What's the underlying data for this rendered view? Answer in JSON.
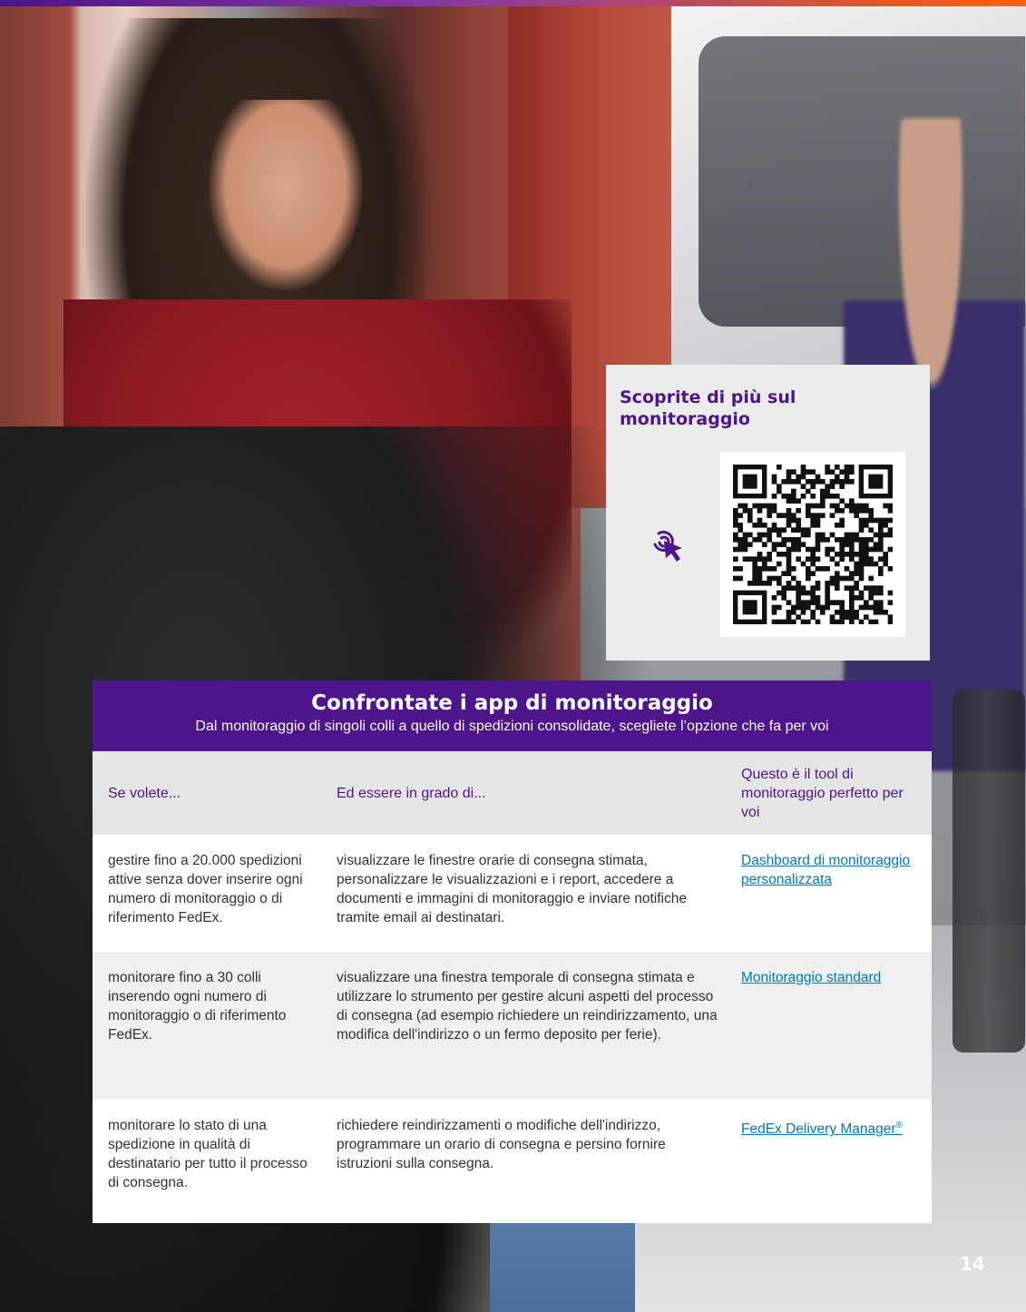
{
  "colors": {
    "brand_purple": "#4d148c",
    "link_blue": "#007ab7",
    "accent_orange": "#ff6200"
  },
  "qr_card": {
    "title": "Scoprite di più sul monitoraggio",
    "cursor_icon": "click-cursor-icon",
    "qr_icon": "qr-code"
  },
  "compare": {
    "title": "Confrontate i app di monitoraggio",
    "subtitle": "Dal monitoraggio di singoli colli a quello di spedizioni consolidate, scegliete l’opzione che fa per voi",
    "headers": [
      "Se volete...",
      "Ed essere in grado di...",
      "Questo è il tool di monitoraggio perfetto per voi"
    ],
    "rows": [
      {
        "want": "gestire fino a 20.000 spedizioni attive senza dover inserire ogni numero di monitoraggio o di riferimento FedEx.",
        "able": "visualizzare le finestre orarie di consegna stimata, personalizzare le visualizzazioni e i report, accedere a documenti e immagini di monitoraggio e inviare notifiche tramite email ai destinatari.",
        "tool": "Dashboard di monitoraggio personalizzata"
      },
      {
        "want": "monitorare fino a 30 colli inserendo ogni numero di monitoraggio o di riferimento FedEx.",
        "able": "visualizzare una finestra temporale di consegna stimata e utilizzare lo strumento per gestire alcuni aspetti del processo di consegna (ad esempio richiedere un reindirizzamento, una modifica dell'indirizzo o un fermo deposito per ferie).",
        "tool": "Monitoraggio standard"
      },
      {
        "want": "monitorare lo stato di una spedizione in qualità di destinatario per tutto il processo di consegna.",
        "able": "richiedere reindirizzamenti o modifiche dell'indirizzo, programmare un orario di consegna e persino fornire istruzioni sulla consegna.",
        "tool": "FedEx Delivery Manager",
        "tool_suffix": "®"
      }
    ]
  },
  "page_number": "14"
}
